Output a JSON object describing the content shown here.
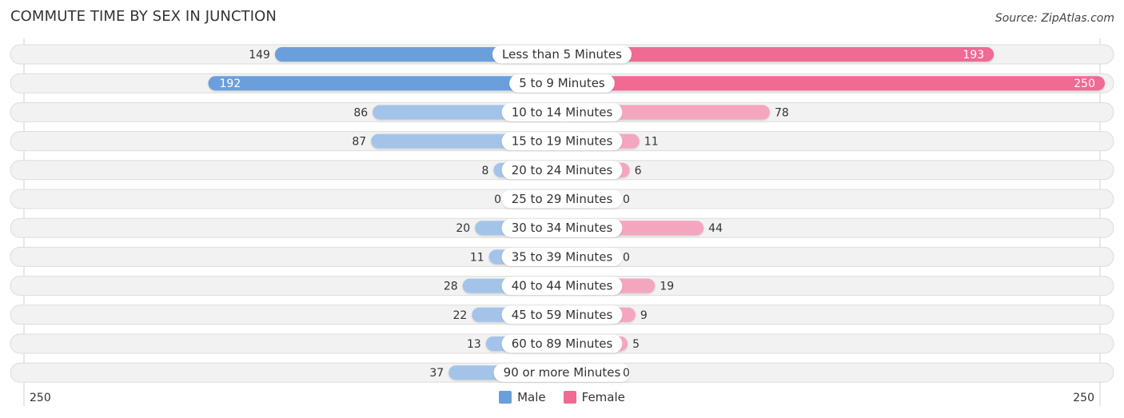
{
  "title": "COMMUTE TIME BY SEX IN JUNCTION",
  "source": "Source: ZipAtlas.com",
  "colors": {
    "male": "#6a9fdb",
    "male_light": "#a3c4e8",
    "female": "#f06a94",
    "female_light": "#f5a6bf",
    "track": "#f2f2f2",
    "track_border": "#dddddd"
  },
  "legend": {
    "male_label": "Male",
    "female_label": "Female"
  },
  "axis": {
    "left_label": "250",
    "right_label": "250"
  },
  "chart_data": {
    "type": "bar",
    "orientation": "horizontal-diverging",
    "title": "COMMUTE TIME BY SEX IN JUNCTION",
    "categories": [
      "Less than 5 Minutes",
      "5 to 9 Minutes",
      "10 to 14 Minutes",
      "15 to 19 Minutes",
      "20 to 24 Minutes",
      "25 to 29 Minutes",
      "30 to 34 Minutes",
      "35 to 39 Minutes",
      "40 to 44 Minutes",
      "45 to 59 Minutes",
      "60 to 89 Minutes",
      "90 or more Minutes"
    ],
    "series": [
      {
        "name": "Male",
        "values": [
          149,
          192,
          86,
          87,
          8,
          0,
          20,
          11,
          28,
          22,
          13,
          37
        ]
      },
      {
        "name": "Female",
        "values": [
          193,
          250,
          78,
          11,
          6,
          0,
          44,
          0,
          19,
          9,
          5,
          0
        ]
      }
    ],
    "xlim": [
      0,
      250
    ],
    "xlabel": "",
    "ylabel": "",
    "legend_position": "bottom-center",
    "grid": false
  }
}
